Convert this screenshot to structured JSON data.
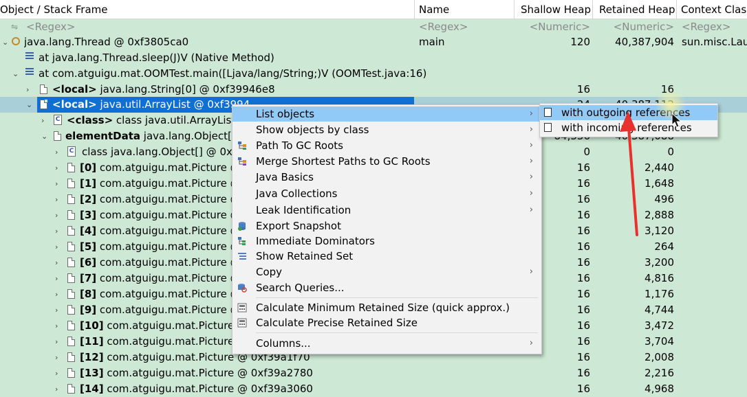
{
  "columns": [
    "Object / Stack Frame",
    "Name",
    "Shallow Heap",
    "Retained Heap",
    "Context Class"
  ],
  "filters": {
    "object": "<Regex>",
    "name": "<Regex>",
    "shallow": "<Numeric>",
    "retained": "<Numeric>",
    "context": "<Regex>"
  },
  "rows": [
    {
      "object": "java.lang.Thread @ 0xf3805ca0",
      "name": "main",
      "shallow": "120",
      "retained": "40,387,904",
      "context": "sun.misc.Laun"
    },
    {
      "object": "at java.lang.Thread.sleep(J)V (Native Method)",
      "name": "",
      "shallow": "",
      "retained": "",
      "context": ""
    },
    {
      "object": "at com.atguigu.mat.OOMTest.main([Ljava/lang/String;)V (OOMTest.java:16)",
      "name": "",
      "shallow": "",
      "retained": "",
      "context": ""
    },
    {
      "prefix": "<local>",
      "object": " java.lang.String[0] @ 0xf39946e8",
      "name": "",
      "shallow": "16",
      "retained": "16",
      "context": ""
    },
    {
      "prefix": "<local>",
      "object": " java.util.ArrayList @ 0xf3994",
      "name": "",
      "shallow": "24",
      "retained": "40,387,112",
      "context": ""
    },
    {
      "prefix": "<class>",
      "object": " class java.util.ArrayList @",
      "name": "",
      "shallow": "",
      "retained": "",
      "context": ""
    },
    {
      "prefix": "elementData",
      "object": " java.lang.Object[21",
      "name": "",
      "shallow": "84,336",
      "retained": "40,387,088",
      "context": ""
    },
    {
      "object": "class java.lang.Object[] @ 0xf3",
      "name": "",
      "shallow": "0",
      "retained": "0",
      "context": ""
    },
    {
      "idx": "[0]",
      "object": " com.atguigu.mat.Picture @",
      "name": "",
      "shallow": "16",
      "retained": "2,440",
      "context": ""
    },
    {
      "idx": "[1]",
      "object": " com.atguigu.mat.Picture @",
      "name": "",
      "shallow": "16",
      "retained": "1,648",
      "context": ""
    },
    {
      "idx": "[2]",
      "object": " com.atguigu.mat.Picture @",
      "name": "",
      "shallow": "16",
      "retained": "496",
      "context": ""
    },
    {
      "idx": "[3]",
      "object": " com.atguigu.mat.Picture @",
      "name": "",
      "shallow": "16",
      "retained": "2,888",
      "context": ""
    },
    {
      "idx": "[4]",
      "object": " com.atguigu.mat.Picture @",
      "name": "",
      "shallow": "16",
      "retained": "3,120",
      "context": ""
    },
    {
      "idx": "[5]",
      "object": " com.atguigu.mat.Picture @",
      "name": "",
      "shallow": "16",
      "retained": "264",
      "context": ""
    },
    {
      "idx": "[6]",
      "object": " com.atguigu.mat.Picture @",
      "name": "",
      "shallow": "16",
      "retained": "3,200",
      "context": ""
    },
    {
      "idx": "[7]",
      "object": " com.atguigu.mat.Picture @",
      "name": "",
      "shallow": "16",
      "retained": "4,816",
      "context": ""
    },
    {
      "idx": "[8]",
      "object": " com.atguigu.mat.Picture @",
      "name": "",
      "shallow": "16",
      "retained": "1,176",
      "context": ""
    },
    {
      "idx": "[9]",
      "object": " com.atguigu.mat.Picture @",
      "name": "",
      "shallow": "16",
      "retained": "4,744",
      "context": ""
    },
    {
      "idx": "[10]",
      "object": " com.atguigu.mat.Picture (",
      "name": "",
      "shallow": "16",
      "retained": "3,472",
      "context": ""
    },
    {
      "idx": "[11]",
      "object": " com.atguigu.mat.Picture (",
      "name": "",
      "shallow": "16",
      "retained": "3,704",
      "context": ""
    },
    {
      "idx": "[12]",
      "object": " com.atguigu.mat.Picture @ 0xf39a1f70",
      "name": "",
      "shallow": "16",
      "retained": "2,008",
      "context": ""
    },
    {
      "idx": "[13]",
      "object": " com.atguigu.mat.Picture @ 0xf39a2780",
      "name": "",
      "shallow": "16",
      "retained": "2,216",
      "context": ""
    },
    {
      "idx": "[14]",
      "object": " com.atguigu.mat.Picture @ 0xf39a3060",
      "name": "",
      "shallow": "16",
      "retained": "4,968",
      "context": ""
    }
  ],
  "context_menu": {
    "items": [
      {
        "label": "List objects",
        "submenu": true
      },
      {
        "label": "Show objects by class",
        "submenu": true
      },
      {
        "label": "Path To GC Roots",
        "submenu": true
      },
      {
        "label": "Merge Shortest Paths to GC Roots",
        "submenu": true
      },
      {
        "label": "Java Basics",
        "submenu": true
      },
      {
        "label": "Java Collections",
        "submenu": true
      },
      {
        "label": "Leak Identification",
        "submenu": true
      },
      {
        "label": "Export Snapshot",
        "submenu": false
      },
      {
        "label": "Immediate Dominators",
        "submenu": false
      },
      {
        "label": "Show Retained Set",
        "submenu": false
      },
      {
        "label": "Copy",
        "submenu": true
      },
      {
        "label": "Search Queries...",
        "submenu": false
      },
      {
        "label": "Calculate Minimum Retained Size (quick approx.)",
        "submenu": false
      },
      {
        "label": "Calculate Precise Retained Size",
        "submenu": false
      },
      {
        "label": "Columns...",
        "submenu": true
      }
    ]
  },
  "submenu": {
    "items": [
      {
        "label": "with outgoing references"
      },
      {
        "label": "with incoming references"
      }
    ]
  },
  "colors": {
    "row_bg": "#cde8d4",
    "selection": "#0f6fd3",
    "menu_highlight": "#91c9f7",
    "annotation_arrow": "#e8312d"
  }
}
